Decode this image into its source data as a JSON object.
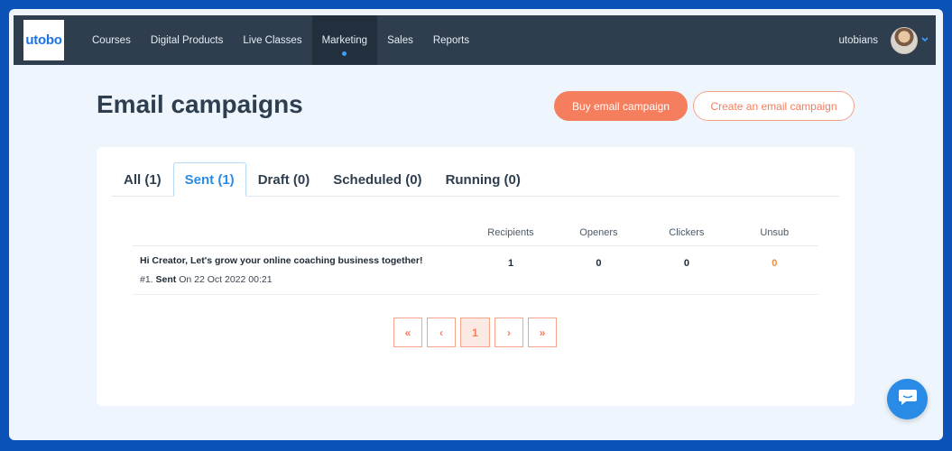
{
  "brand": {
    "logo_text": "utobo",
    "accent": "#2a8be6",
    "cta_color": "#f47e5e"
  },
  "nav": {
    "items": [
      {
        "label": "Courses"
      },
      {
        "label": "Digital Products"
      },
      {
        "label": "Live Classes"
      },
      {
        "label": "Marketing",
        "active": true
      },
      {
        "label": "Sales"
      },
      {
        "label": "Reports"
      }
    ],
    "username": "utobians",
    "caret_icon": "chevron-down-icon"
  },
  "header": {
    "title": "Email campaigns",
    "buy_button": "Buy email campaign",
    "create_button": "Create an email campaign"
  },
  "tabs": [
    {
      "label": "All (1)"
    },
    {
      "label": "Sent (1)",
      "active": true
    },
    {
      "label": "Draft (0)"
    },
    {
      "label": "Scheduled (0)"
    },
    {
      "label": "Running (0)"
    }
  ],
  "table": {
    "columns": [
      "Recipients",
      "Openers",
      "Clickers",
      "Unsub"
    ],
    "rows": [
      {
        "subject": "Hi Creator, Let's grow your online coaching business together!",
        "index": "#1.",
        "status": "Sent",
        "date": "On 22 Oct 2022 00:21",
        "recipients": "1",
        "openers": "0",
        "clickers": "0",
        "unsub": "0"
      }
    ]
  },
  "pagination": {
    "first": "«",
    "prev": "‹",
    "current": "1",
    "next": "›",
    "last": "»"
  },
  "chat": {
    "icon": "chat-bubble-icon"
  }
}
